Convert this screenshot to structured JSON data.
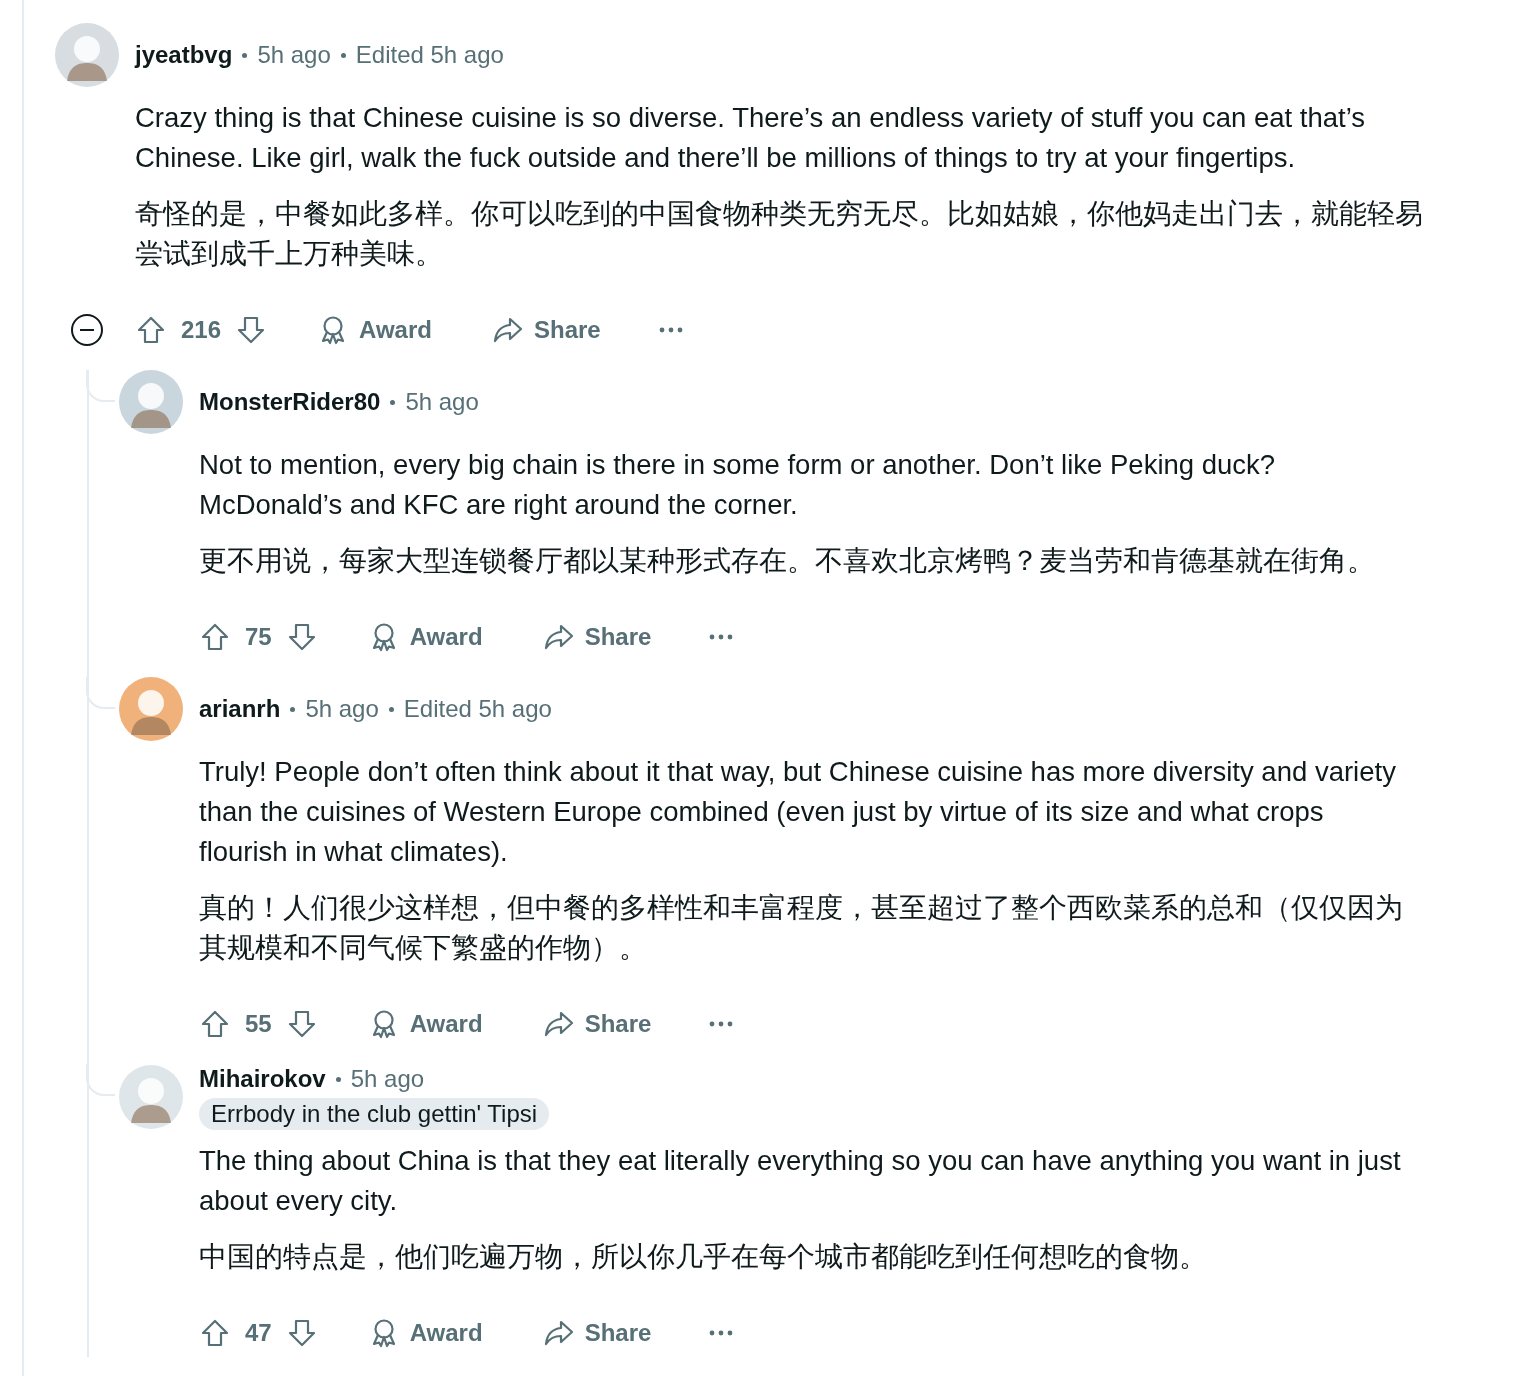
{
  "comments": [
    {
      "author": "jyeatbvg",
      "avatar": {
        "color": "#d7dde0"
      },
      "timestamp": "5h ago",
      "edited": "Edited 5h ago",
      "paragraphs": [
        "Crazy thing is that Chinese cuisine is so diverse. There’s an endless variety of stuff you can eat that’s Chinese. Like girl, walk the fuck outside and there’ll be millions of things to try at your fingertips.",
        "奇怪的是，中餐如此多样。你可以吃到的中国食物种类无穷无尽。比如姑娘，你他妈走出门去，就能轻易尝试到成千上万种美味。"
      ],
      "expanded": true,
      "votes": "216",
      "actions": [
        "Award",
        "Share"
      ],
      "children": [
        {
          "author": "MonsterRider80",
          "avatar": {
            "color": "#c9d6de"
          },
          "timestamp": "5h ago",
          "paragraphs": [
            "Not to mention, every big chain is there in some form or another. Don’t like Peking duck? McDonald’s and KFC are right around the corner.",
            "更不用说，每家大型连锁餐厅都以某种形式存在。不喜欢北京烤鸭？麦当劳和肯德基就在街角。"
          ],
          "votes": "75",
          "actions": [
            "Award",
            "Share"
          ]
        },
        {
          "author": "arianrh",
          "avatar": {
            "color": "#f0b27a"
          },
          "timestamp": "5h ago",
          "edited": "Edited 5h ago",
          "paragraphs": [
            "Truly! People don’t often think about it that way, but Chinese cuisine has more diversity and variety than the cuisines of Western Europe combined (even just by virtue of its size and what crops flourish in what climates).",
            "真的！人们很少这样想，但中餐的多样性和丰富程度，甚至超过了整个西欧菜系的总和（仅仅因为其规模和不同气候下繁盛的作物）。"
          ],
          "votes": "55",
          "actions": [
            "Award",
            "Share"
          ]
        },
        {
          "author": "Mihairokov",
          "avatar": {
            "color": "#dfe6ea"
          },
          "timestamp": "5h ago",
          "flair": "Errbody in the club gettin' Tipsi",
          "paragraphs": [
            "The thing about China is that they eat literally everything so you can have anything you want in just about every city.",
            "中国的特点是，他们吃遍万物，所以你几乎在每个城市都能吃到任何想吃的食物。"
          ],
          "votes": "47",
          "actions": [
            "Award",
            "Share"
          ]
        }
      ]
    }
  ]
}
